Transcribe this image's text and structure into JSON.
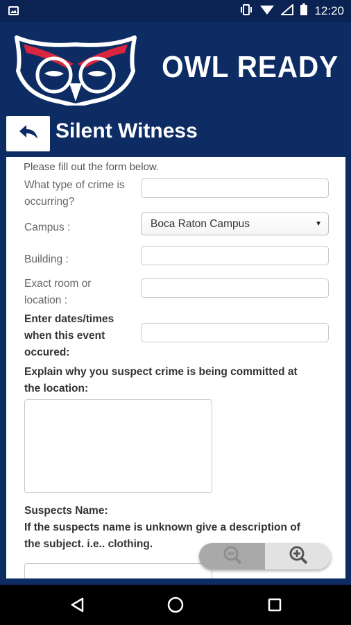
{
  "status_bar": {
    "time": "12:20",
    "icons": [
      "image-icon",
      "vibrate-icon",
      "wifi-icon",
      "signal-icon",
      "battery-icon"
    ]
  },
  "header": {
    "app_title": "OWL READY",
    "logo": "owl-logo",
    "colors": {
      "background": "#0d2c64",
      "accent": "#d7263d"
    }
  },
  "page": {
    "title": "Silent Witness",
    "back_icon": "reply-arrow-icon"
  },
  "form": {
    "intro": "Please fill out the form below.",
    "crime_type": {
      "label_line1": "What type of crime is",
      "label_line2": "occurring?",
      "value": ""
    },
    "campus": {
      "label": "Campus :",
      "selected": "Boca Raton Campus"
    },
    "building": {
      "label": "Building :",
      "value": ""
    },
    "room": {
      "label_line1": "Exact room or",
      "label_line2": "location :",
      "value": ""
    },
    "dates": {
      "label_line1": "Enter dates/times",
      "label_line2": "when this event",
      "label_line3": "occured:",
      "value": ""
    },
    "explain": {
      "label_line1": "Explain why you suspect crime is being committed at",
      "label_line2": "the location:",
      "value": ""
    },
    "suspects": {
      "label_line1": "Suspects Name:",
      "label_line2": "If the suspects name is unknown give a description of",
      "label_line3": "the subject. i.e.. clothing.",
      "value": ""
    }
  },
  "zoom_control": {
    "icons": [
      "zoom-out-icon",
      "zoom-in-icon"
    ]
  },
  "nav_bar": {
    "icons": [
      "back-triangle-icon",
      "home-circle-icon",
      "recents-square-icon"
    ]
  }
}
